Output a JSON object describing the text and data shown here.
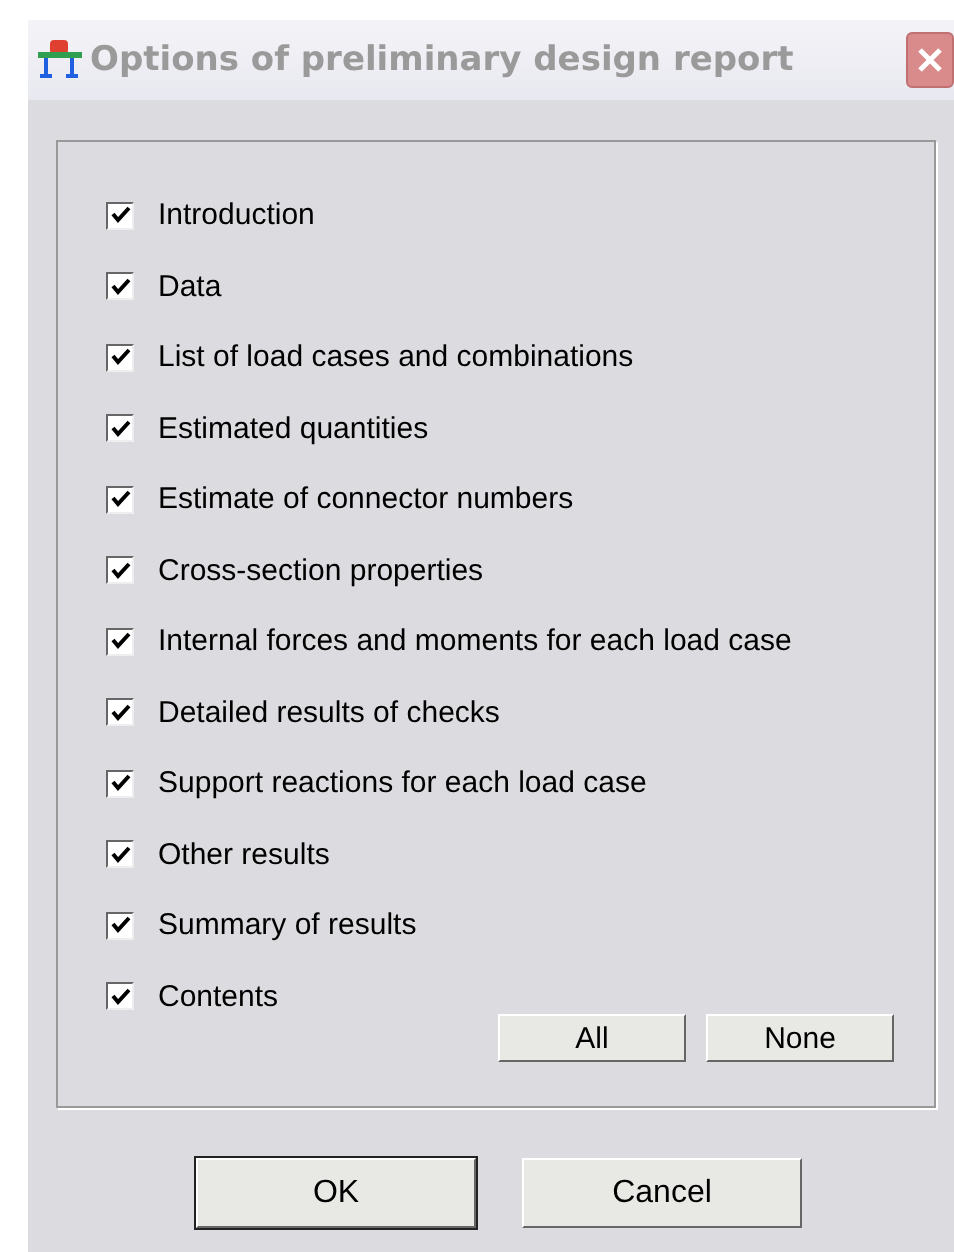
{
  "window": {
    "title": "Options of preliminary design report"
  },
  "options": [
    {
      "label": "Introduction",
      "checked": true
    },
    {
      "label": "Data",
      "checked": true
    },
    {
      "label": "List of load cases and combinations",
      "checked": true
    },
    {
      "label": "Estimated quantities",
      "checked": true
    },
    {
      "label": "Estimate of connector numbers",
      "checked": true
    },
    {
      "label": "Cross-section properties",
      "checked": true
    },
    {
      "label": "Internal forces and moments for each load case",
      "checked": true
    },
    {
      "label": "Detailed results of checks",
      "checked": true
    },
    {
      "label": "Support reactions for each load case",
      "checked": true
    },
    {
      "label": "Other results",
      "checked": true
    },
    {
      "label": "Summary of results",
      "checked": true
    },
    {
      "label": "Contents",
      "checked": true
    }
  ],
  "select_buttons": [
    "All",
    "None"
  ],
  "buttons": [
    {
      "label": "OK",
      "default": true
    },
    {
      "label": "Cancel",
      "default": false
    }
  ]
}
